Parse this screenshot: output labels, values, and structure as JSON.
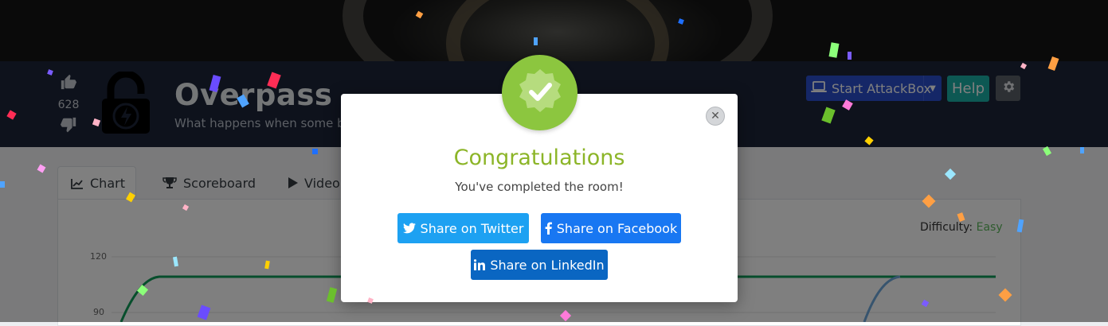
{
  "room": {
    "title": "Overpass",
    "description": "What happens when some br",
    "votes": "628",
    "difficulty_label": "Difficulty:",
    "difficulty_value": "Easy"
  },
  "header_buttons": {
    "attackbox": "Start AttackBox",
    "help": "Help"
  },
  "tabs": [
    {
      "label": "Chart",
      "icon": "chart-line-icon"
    },
    {
      "label": "Scoreboard",
      "icon": "trophy-icon"
    },
    {
      "label": "Video",
      "icon": "play-icon"
    }
  ],
  "chart_data": {
    "type": "line",
    "y_ticks": [
      "120",
      "90"
    ]
  },
  "modal": {
    "title": "Congratulations",
    "message": "You've completed the room!",
    "share_twitter": "Share on Twitter",
    "share_facebook": "Share on Facebook",
    "share_linkedin": "Share on LinkedIn"
  },
  "colors": {
    "success": "#8cc63f",
    "twitter": "#1da1f2",
    "facebook": "#1877f2",
    "linkedin": "#0a66c2",
    "attackbox": "#2a4fcf",
    "help": "#1bb1a6"
  }
}
